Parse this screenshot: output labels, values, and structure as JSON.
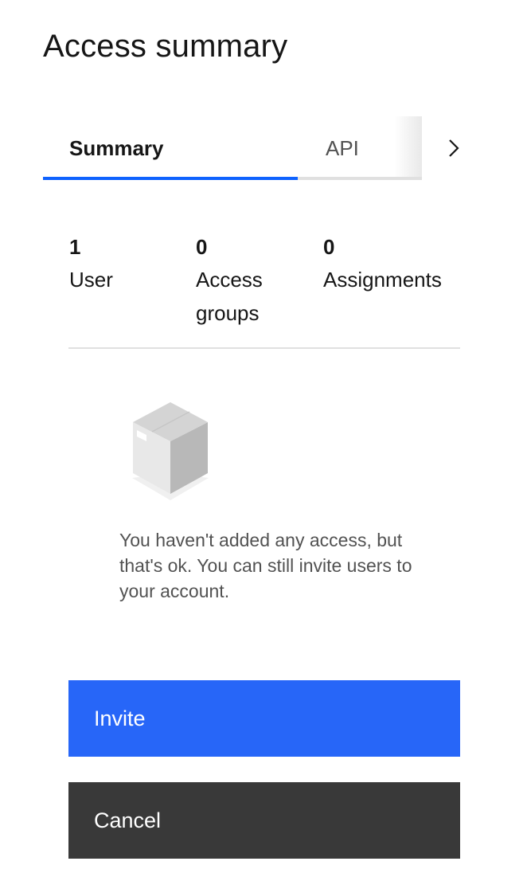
{
  "panel": {
    "title": "Access summary"
  },
  "tabs": [
    {
      "label": "Summary",
      "selected": true
    },
    {
      "label": "API",
      "selected": false
    }
  ],
  "tabs_scroll_icon": "chevron-right-icon",
  "stats": [
    {
      "count": "1",
      "label": "User"
    },
    {
      "count": "0",
      "label": "Access groups"
    },
    {
      "count": "0",
      "label": "Assignments"
    }
  ],
  "empty_state": {
    "illustration": "box-icon",
    "message": "You haven't added any access, but that's ok. You can still invite users to your account."
  },
  "buttons": {
    "invite_label": "Invite",
    "cancel_label": "Cancel"
  },
  "colors": {
    "primary": "#2766f8",
    "secondary": "#393939",
    "tab_selected_border": "#0f62fe",
    "text": "#161616",
    "muted_text": "#525252",
    "divider": "#e0e0e0"
  }
}
